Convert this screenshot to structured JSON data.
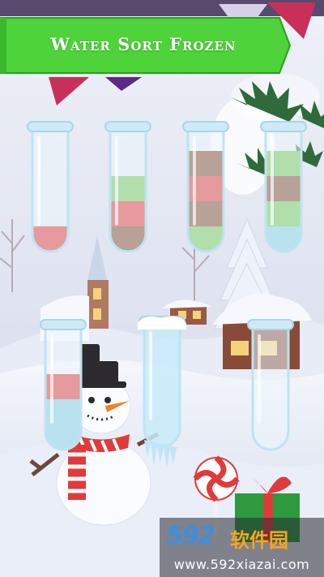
{
  "game": {
    "title": "Water Sort Frozen"
  },
  "colors": {
    "red": "#e12b2b",
    "green": "#6cc04a",
    "brown": "#7a3a1e",
    "blue": "#7ec7de",
    "banner_green": "#4fd33a",
    "ribbon_purple": "#5b2a86",
    "ribbon_pink": "#c8305a"
  },
  "tubes": [
    {
      "id": 1,
      "layers": [
        "red"
      ],
      "frozen": false
    },
    {
      "id": 2,
      "layers": [
        "brown",
        "red",
        "green"
      ],
      "frozen": false
    },
    {
      "id": 3,
      "layers": [
        "green",
        "brown",
        "red",
        "brown"
      ],
      "frozen": false
    },
    {
      "id": 4,
      "layers": [
        "blue",
        "green",
        "brown",
        "green"
      ],
      "frozen": false
    },
    {
      "id": 5,
      "layers": [
        "blue",
        "blue",
        "red"
      ],
      "frozen": false
    },
    {
      "id": 6,
      "layers": [],
      "frozen": true
    },
    {
      "id": 7,
      "layers": [],
      "frozen": false
    }
  ],
  "watermark": {
    "number": "592",
    "chinese": "软件园",
    "url": "www.592xiazai.com"
  }
}
